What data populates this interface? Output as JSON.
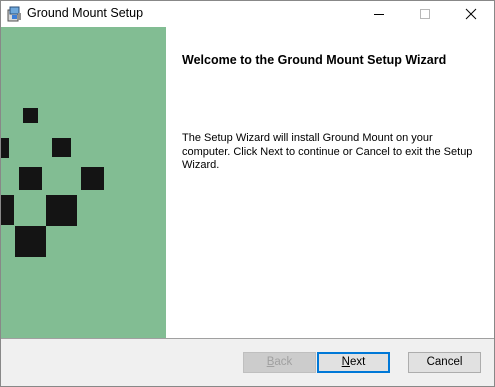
{
  "window": {
    "title": "Ground Mount Setup"
  },
  "titlebar": {
    "minimize_icon": "minimize-icon",
    "maximize_icon": "maximize-icon",
    "close_icon": "close-icon"
  },
  "content": {
    "heading": "Welcome to the Ground Mount Setup Wizard",
    "body": "The Setup Wizard will install Ground Mount on your computer. Click Next to continue or Cancel to exit the Setup Wizard."
  },
  "buttons": {
    "back": {
      "label": "Back",
      "underline": "B",
      "rest": "ack",
      "enabled": false
    },
    "next": {
      "label": "Next",
      "underline": "N",
      "rest": "ext",
      "enabled": true,
      "default": true
    },
    "cancel": {
      "label": "Cancel",
      "enabled": true
    }
  },
  "colors": {
    "banner": "#82bd93",
    "pixel": "#141414",
    "footer": "#f0f0f0",
    "default_button_border": "#0078d7"
  }
}
